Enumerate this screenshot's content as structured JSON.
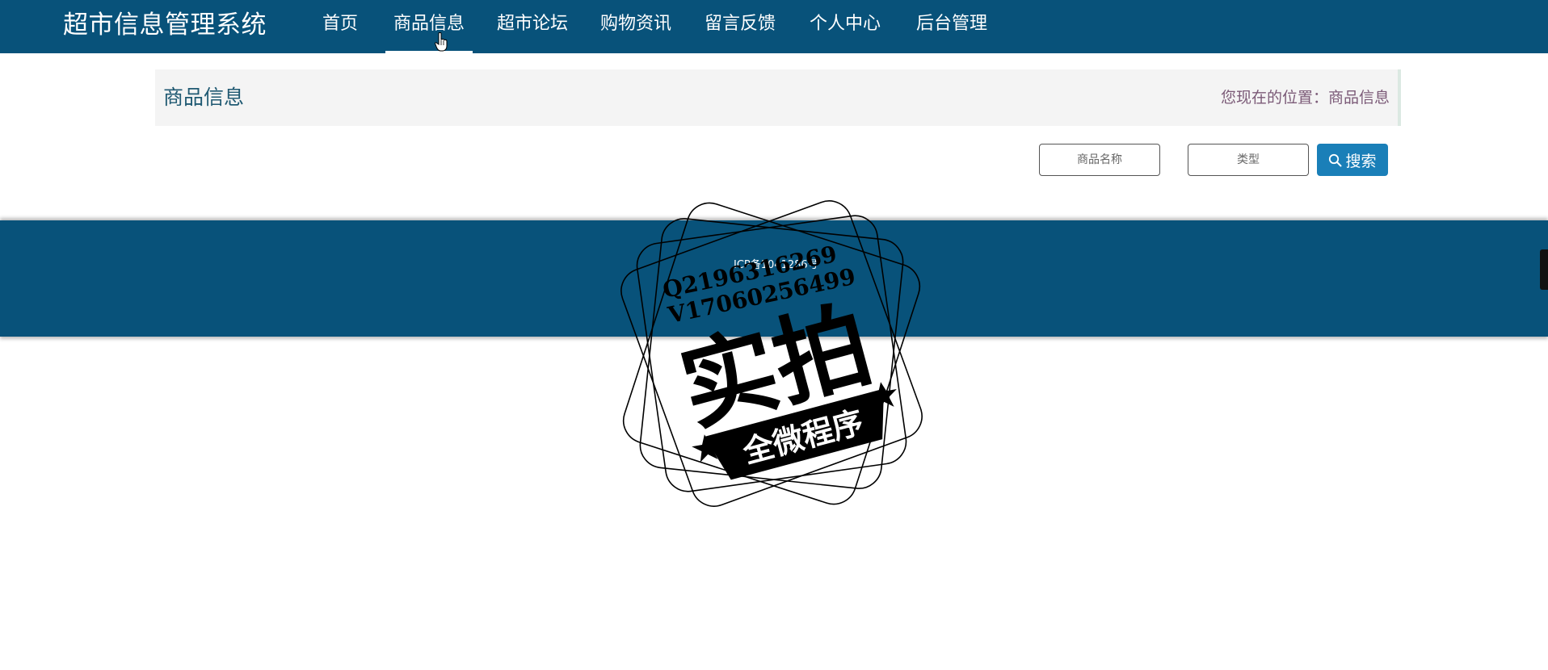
{
  "app": {
    "title": "超市信息管理系统"
  },
  "nav": {
    "items": [
      {
        "label": "首页"
      },
      {
        "label": "商品信息"
      },
      {
        "label": "超市论坛"
      },
      {
        "label": "购物资讯"
      },
      {
        "label": "留言反馈"
      },
      {
        "label": "个人中心"
      },
      {
        "label": "后台管理"
      }
    ],
    "active": "商品信息"
  },
  "page": {
    "title": "商品信息",
    "location_label": "您现在的位置：",
    "location_current": "商品信息"
  },
  "search": {
    "name_placeholder": "商品名称",
    "type_placeholder": "类型",
    "button_label": "搜索"
  },
  "footer": {
    "icp": "ICP备1041286号"
  },
  "watermark": {
    "line1": "Q2196316269",
    "line2": "V17060256499",
    "main": "实拍",
    "banner": "全微程序"
  },
  "colors": {
    "nav_bg": "#08527a",
    "button_bg": "#1a7fb8",
    "title_text": "#1f5972",
    "location_text": "#7b5a77"
  }
}
